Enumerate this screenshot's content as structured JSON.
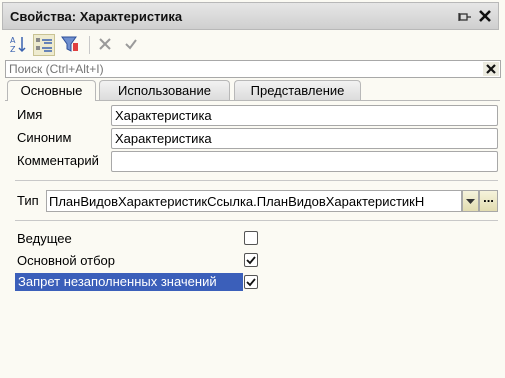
{
  "window": {
    "title": "Свойства: Характеристика"
  },
  "toolbar": {
    "buttons": [
      {
        "icon": "sort-alphabetical-icon"
      },
      {
        "icon": "categorized-view-icon",
        "active": true
      },
      {
        "icon": "filter-icon"
      },
      {
        "icon": "cancel-icon"
      },
      {
        "icon": "apply-check-icon"
      }
    ]
  },
  "search": {
    "placeholder": "Поиск (Ctrl+Alt+I)",
    "value": ""
  },
  "tabs": [
    {
      "label": "Основные",
      "active": true
    },
    {
      "label": "Использование",
      "active": false
    },
    {
      "label": "Представление",
      "active": false
    }
  ],
  "fields": {
    "name_label": "Имя",
    "name_value": "Характеристика",
    "synonym_label": "Синоним",
    "synonym_value": "Характеристика",
    "comment_label": "Комментарий",
    "comment_value": "",
    "type_label": "Тип",
    "type_value": "ПланВидовХарактеристикСсылка.ПланВидовХарактеристикН",
    "more_button": "..."
  },
  "checkboxes": [
    {
      "label": "Ведущее",
      "checked": false,
      "selected": false
    },
    {
      "label": "Основной отбор",
      "checked": true,
      "selected": false
    },
    {
      "label": "Запрет незаполненных значений",
      "checked": true,
      "selected": true
    }
  ],
  "colors": {
    "selection": "#3b5fba",
    "background": "#fbfaf3"
  }
}
